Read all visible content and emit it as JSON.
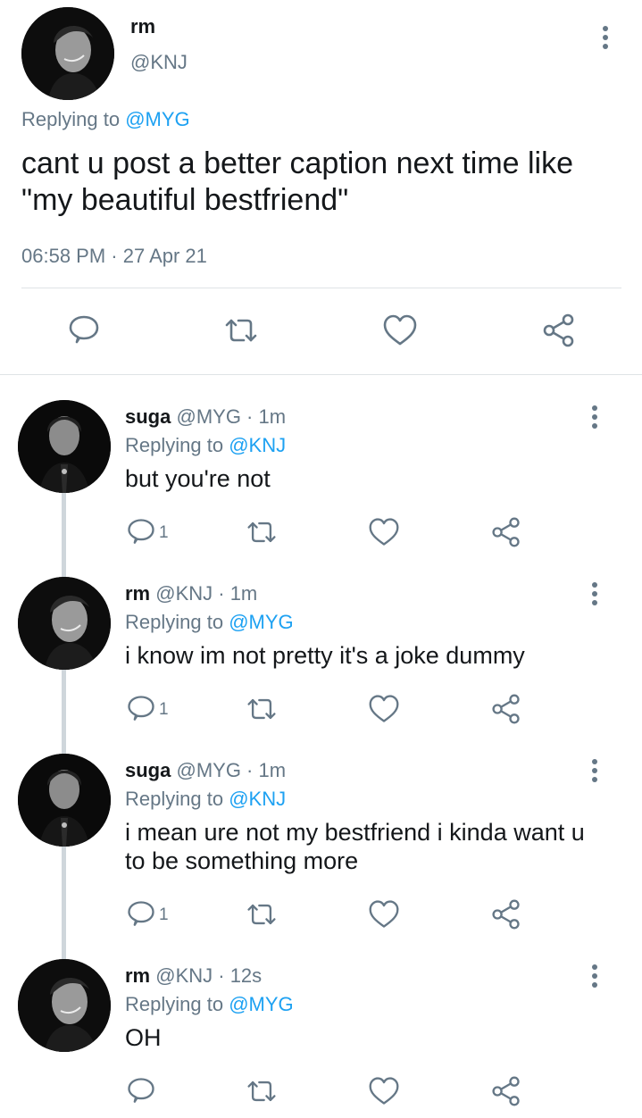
{
  "main_tweet": {
    "name": "rm",
    "handle": "@KNJ",
    "replying_prefix": "Replying to",
    "replying_to": "@MYG",
    "text": "cant u post a better caption next time like \"my beautiful bestfriend\"",
    "timestamp": "06:58 PM · 27 Apr 21",
    "actions": [
      "reply-icon",
      "retweet-icon",
      "like-icon",
      "share-icon"
    ]
  },
  "replies": [
    {
      "name": "suga",
      "meta": "@MYG · 1m",
      "replying_prefix": "Replying to",
      "replying_to": "@KNJ",
      "text": "but you're not",
      "reply_count": "1"
    },
    {
      "name": "rm",
      "meta": "@KNJ · 1m",
      "replying_prefix": "Replying to",
      "replying_to": "@MYG",
      "text": "i know im not pretty it's a joke dummy",
      "reply_count": "1"
    },
    {
      "name": "suga",
      "meta": "@MYG · 1m",
      "replying_prefix": "Replying to",
      "replying_to": "@KNJ",
      "text": "i mean ure not my bestfriend i kinda want u to be something more",
      "reply_count": "1"
    },
    {
      "name": "rm",
      "meta": "@KNJ · 12s",
      "replying_prefix": "Replying to",
      "replying_to": "@MYG",
      "text": "OH",
      "reply_count": ""
    }
  ],
  "colors": {
    "text": "#14171a",
    "secondary": "#657786",
    "link": "#1da1f2",
    "divider": "#dfe3e6",
    "thread_line": "#cfd6db"
  }
}
